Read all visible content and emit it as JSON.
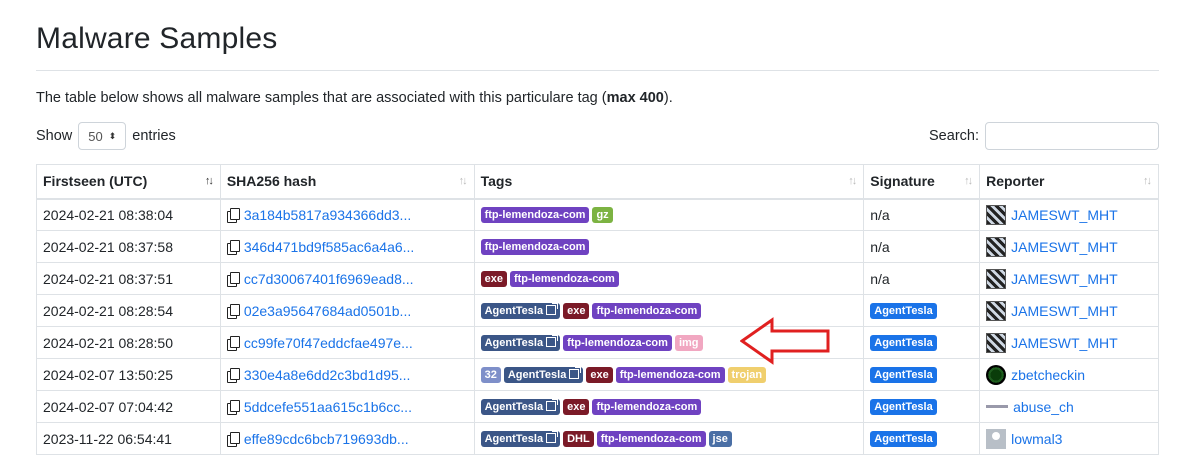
{
  "page": {
    "title": "Malware Samples",
    "intro_text": "The table below shows all malware samples that are associated with this particulare tag (",
    "intro_bold": "max 400",
    "intro_end": ")."
  },
  "controls": {
    "show_label": "Show",
    "entries_value": "50",
    "entries_label": "entries",
    "search_label": "Search:"
  },
  "table": {
    "columns": [
      "Firstseen (UTC)",
      "SHA256 hash",
      "Tags",
      "Signature",
      "Reporter"
    ],
    "rows": [
      {
        "firstseen": "2024-02-21 08:38:04",
        "hash": "3a184b5817a934366dd3...",
        "tags": [
          {
            "text": "ftp-lemendoza-com",
            "color": "#6f42c1"
          },
          {
            "text": "gz",
            "color": "#7cb342"
          }
        ],
        "signature": "n/a",
        "reporter": "JAMESWT_MHT",
        "avatar": "jameswt"
      },
      {
        "firstseen": "2024-02-21 08:37:58",
        "hash": "346d471bd9f585ac6a4a6...",
        "tags": [
          {
            "text": "ftp-lemendoza-com",
            "color": "#6f42c1"
          }
        ],
        "signature": "n/a",
        "reporter": "JAMESWT_MHT",
        "avatar": "jameswt"
      },
      {
        "firstseen": "2024-02-21 08:37:51",
        "hash": "cc7d30067401f6969ead8...",
        "tags": [
          {
            "text": "exe",
            "color": "#7b1a27"
          },
          {
            "text": "ftp-lemendoza-com",
            "color": "#6f42c1"
          }
        ],
        "signature": "n/a",
        "reporter": "JAMESWT_MHT",
        "avatar": "jameswt"
      },
      {
        "firstseen": "2024-02-21 08:28:54",
        "hash": "02e3a95647684ad0501b...",
        "tags": [
          {
            "text": "AgentTesla",
            "color": "#3b5687",
            "ext": true
          },
          {
            "text": "exe",
            "color": "#7b1a27"
          },
          {
            "text": "ftp-lemendoza-com",
            "color": "#6f42c1"
          }
        ],
        "signature": "AgentTesla",
        "signature_badge": true,
        "reporter": "JAMESWT_MHT",
        "avatar": "jameswt"
      },
      {
        "firstseen": "2024-02-21 08:28:50",
        "hash": "cc99fe70f47eddcfae497e...",
        "tags": [
          {
            "text": "AgentTesla",
            "color": "#3b5687",
            "ext": true
          },
          {
            "text": "ftp-lemendoza-com",
            "color": "#6f42c1"
          },
          {
            "text": "img",
            "color": "#f1a7c1"
          }
        ],
        "signature": "AgentTesla",
        "signature_badge": true,
        "reporter": "JAMESWT_MHT",
        "avatar": "jameswt"
      },
      {
        "firstseen": "2024-02-07 13:50:25",
        "hash": "330e4a8e6dd2c3bd1d95...",
        "tags": [
          {
            "text": "32",
            "color": "#7e8fc9"
          },
          {
            "text": "AgentTesla",
            "color": "#3b5687",
            "ext": true
          },
          {
            "text": "exe",
            "color": "#7b1a27"
          },
          {
            "text": "ftp-lemendoza-com",
            "color": "#6f42c1"
          },
          {
            "text": "trojan",
            "color": "#f0cf6e"
          }
        ],
        "signature": "AgentTesla",
        "signature_badge": true,
        "reporter": "zbetcheckin",
        "avatar": "zbet"
      },
      {
        "firstseen": "2024-02-07 07:04:42",
        "hash": "5ddcefe551aa615c1b6cc...",
        "tags": [
          {
            "text": "AgentTesla",
            "color": "#3b5687",
            "ext": true
          },
          {
            "text": "exe",
            "color": "#7b1a27"
          },
          {
            "text": "ftp-lemendoza-com",
            "color": "#6f42c1"
          }
        ],
        "signature": "AgentTesla",
        "signature_badge": true,
        "reporter": "abuse_ch",
        "avatar": "abuse"
      },
      {
        "firstseen": "2023-11-22 06:54:41",
        "hash": "effe89cdc6bcb719693db...",
        "tags": [
          {
            "text": "AgentTesla",
            "color": "#3b5687",
            "ext": true
          },
          {
            "text": "DHL",
            "color": "#7b1a27"
          },
          {
            "text": "ftp-lemendoza-com",
            "color": "#6f42c1"
          },
          {
            "text": "jse",
            "color": "#4a6fa5"
          }
        ],
        "signature": "AgentTesla",
        "signature_badge": true,
        "reporter": "lowmal3",
        "avatar": "lowmal"
      }
    ]
  },
  "colors": {
    "link": "#1a73e8",
    "signature_badge": "#1a73e8",
    "arrow": "#e02020"
  }
}
